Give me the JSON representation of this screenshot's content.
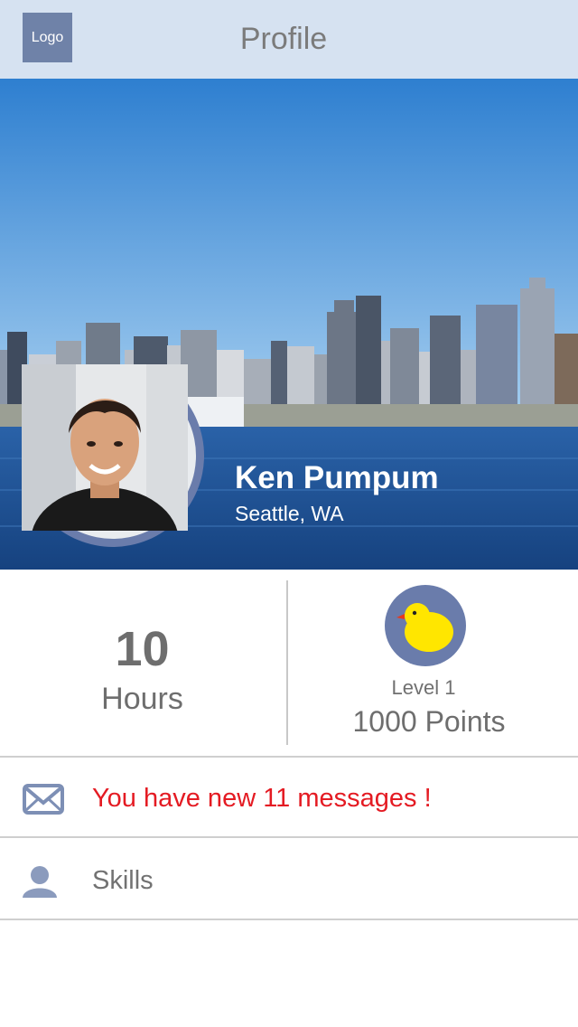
{
  "navbar": {
    "logo_label": "Logo",
    "title": "Profile",
    "background_color": "#d6e2f1"
  },
  "profile": {
    "name": "Ken Pumpum",
    "location": "Seattle, WA",
    "cover_image": "seattle-skyline",
    "avatar_image": "user-photo"
  },
  "stats": {
    "hours_value": "10",
    "hours_label": "Hours",
    "level_label": "Level 1",
    "points_label": "1000 Points",
    "badge_icon": "chick-icon"
  },
  "list": {
    "messages_text": "You have new 11 messages !",
    "messages_icon": "envelope-icon",
    "skills_text": "Skills",
    "skills_icon": "person-icon"
  },
  "colors": {
    "accent": "#6a7cab",
    "alert": "#e41b23"
  }
}
